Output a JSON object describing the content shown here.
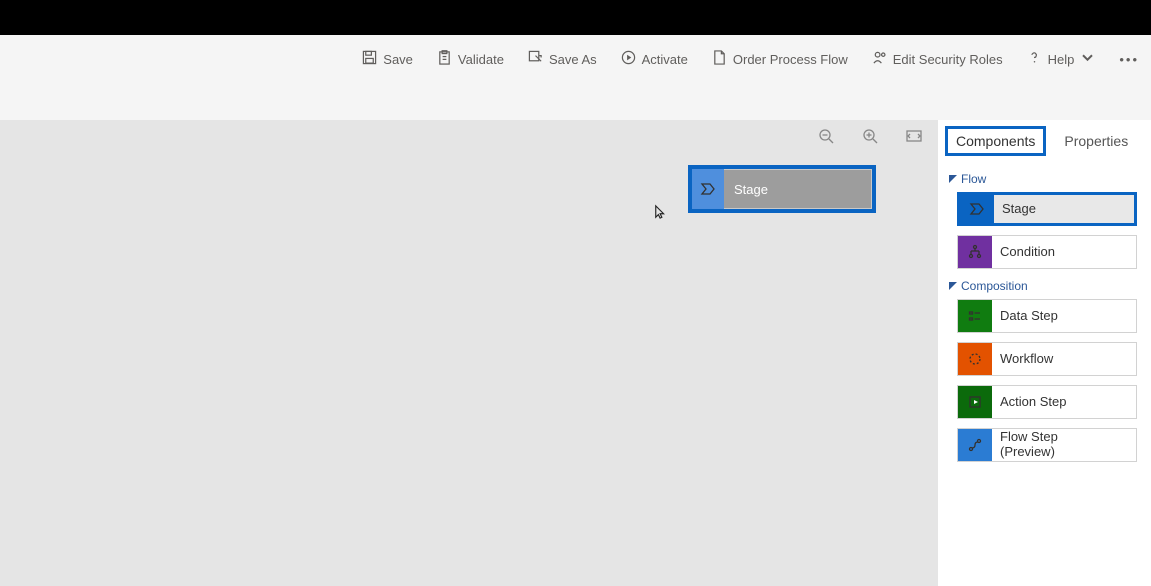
{
  "toolbar": {
    "save": "Save",
    "validate": "Validate",
    "save_as": "Save As",
    "activate": "Activate",
    "process_flow": "Order Process Flow",
    "edit_security": "Edit Security Roles",
    "help": "Help"
  },
  "canvas": {
    "dragged_stage_label": "Stage"
  },
  "side_panel": {
    "tabs": {
      "components": "Components",
      "properties": "Properties"
    },
    "sections": {
      "flow": "Flow",
      "composition": "Composition"
    },
    "flow_items": {
      "stage": "Stage",
      "condition": "Condition"
    },
    "composition_items": {
      "data_step": "Data Step",
      "workflow": "Workflow",
      "action_step": "Action Step",
      "flow_step": "Flow Step\n(Preview)"
    }
  }
}
